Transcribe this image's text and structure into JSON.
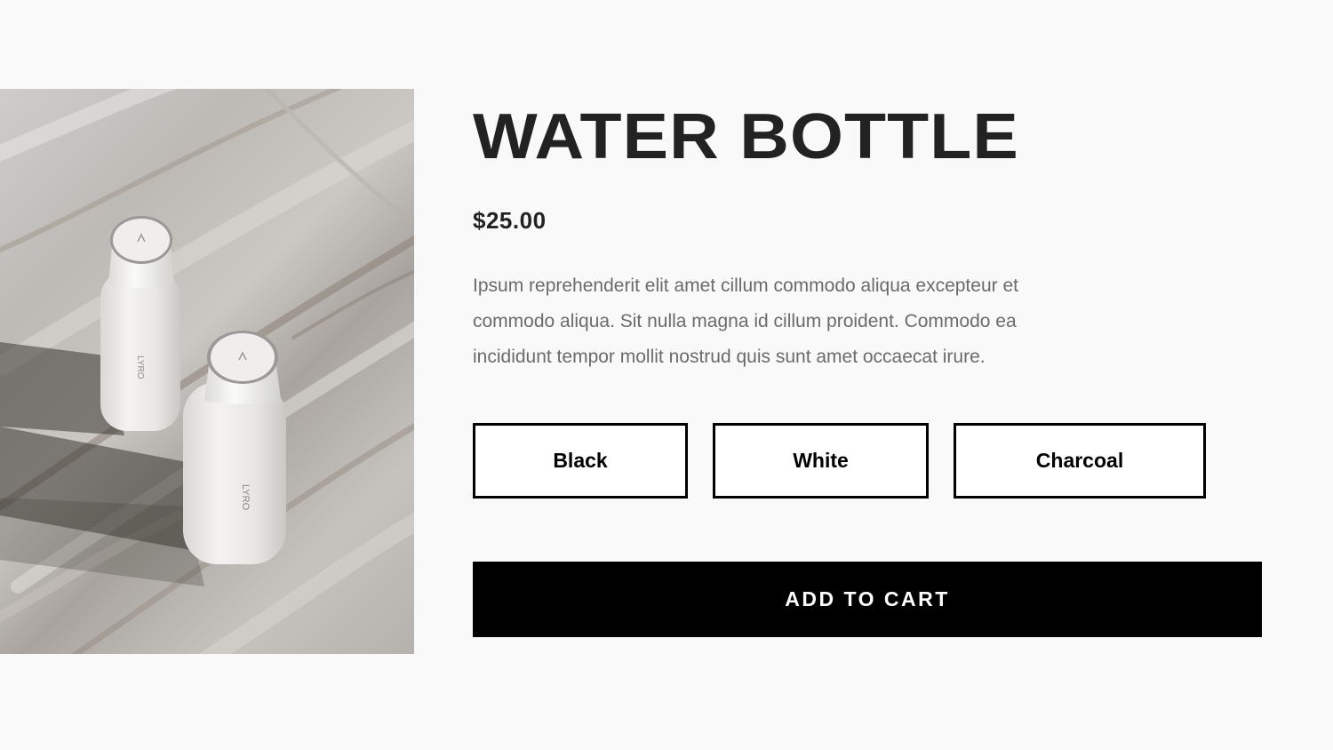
{
  "product": {
    "title": "WATER BOTTLE",
    "price": "$25.00",
    "description": "Ipsum reprehenderit elit amet cillum commodo aliqua excepteur et commodo aliqua. Sit nulla magna id cillum proident. Commodo ea incididunt tempor mollit nostrud quis sunt amet occaecat irure.",
    "bottle_brand": "LYRO"
  },
  "options": {
    "black_label": "Black",
    "white_label": "White",
    "charcoal_label": "Charcoal"
  },
  "cart": {
    "button_label": "ADD TO CART"
  },
  "colors": {
    "background": "#f9f9f9",
    "text_dark": "#222222",
    "text_muted": "#6b6b6b",
    "button_bg": "#000000",
    "button_text": "#ffffff"
  }
}
